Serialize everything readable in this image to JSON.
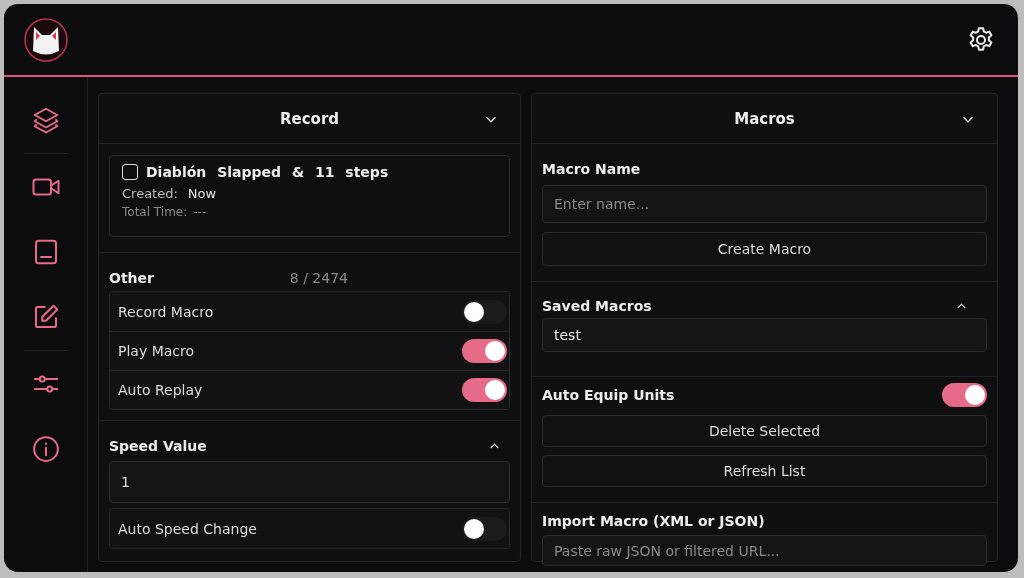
{
  "record_panel": {
    "title": "Record",
    "expanded": false,
    "macro_entry": {
      "checked": false,
      "title": "Diablón Slapped & 11 steps",
      "created_label": "Created:",
      "created_value": "Now",
      "total_label": "Total Time:",
      "total_value": "---"
    },
    "other": {
      "label": "Other",
      "count": "8 / 2474"
    },
    "toggles": [
      {
        "label": "Record Macro",
        "on": false
      },
      {
        "label": "Play Macro",
        "on": true
      },
      {
        "label": "Auto Replay",
        "on": true
      }
    ],
    "speed": {
      "label": "Speed Value",
      "expanded": true,
      "value": "1",
      "toggle": {
        "label": "Auto Speed Change",
        "on": false
      }
    }
  },
  "macros_panel": {
    "title": "Macros",
    "expanded": false,
    "name_label": "Macro Name",
    "name_placeholder": "Enter name...",
    "create_button": "Create Macro",
    "saved_label": "Saved Macros",
    "saved_expanded": true,
    "saved_items": [
      {
        "label": "test",
        "selected": false
      }
    ],
    "auto_equip": {
      "label": "Auto Equip Units",
      "on": true
    },
    "buttons": [
      "Delete Selected",
      "Refresh List"
    ],
    "import_label": "Import Macro (XML or JSON)",
    "import_placeholder": "Paste raw JSON or filtered URL..."
  }
}
